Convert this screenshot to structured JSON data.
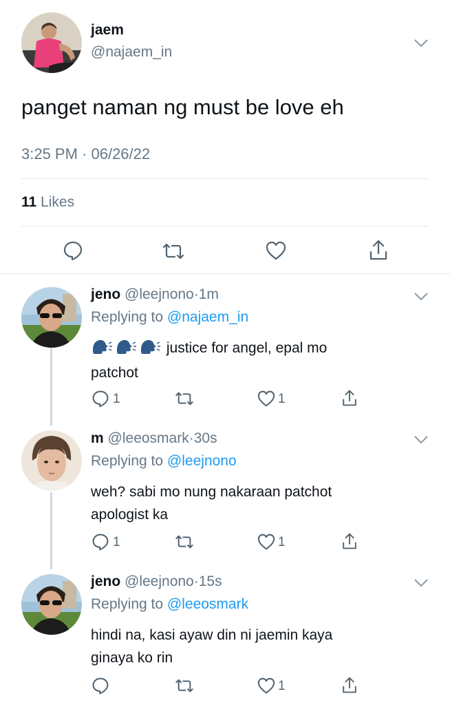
{
  "main_tweet": {
    "display_name": "jaem",
    "handle": "@najaem_in",
    "text": "panget naman ng must be love eh",
    "timestamp": "3:25 PM · 06/26/22",
    "likes_count": "11",
    "likes_label": "Likes"
  },
  "replies": [
    {
      "display_name": "jeno",
      "handle": "@leejnono",
      "time": "1m",
      "replying_prefix": "Replying to",
      "replying_to": "@najaem_in",
      "text_line1": "justice for angel, epal mo",
      "text_line2": "patchot",
      "reply_count": "1",
      "like_count": "1"
    },
    {
      "display_name": "m",
      "handle": "@leeosmark",
      "time": "30s",
      "replying_prefix": "Replying to",
      "replying_to": "@leejnono",
      "text_line1": "weh? sabi mo nung nakaraan patchot",
      "text_line2": "apologist ka",
      "reply_count": "1",
      "like_count": "1"
    },
    {
      "display_name": "jeno",
      "handle": "@leejnono",
      "time": "15s",
      "replying_prefix": "Replying to",
      "replying_to": "@leeosmark",
      "text_line1": "hindi na, kasi ayaw din ni jaemin kaya",
      "text_line2": "ginaya ko rin",
      "reply_count": "",
      "like_count": "1"
    }
  ],
  "separator": "·",
  "emoji": "speaking-head-emoji",
  "colors": {
    "link": "#1d9bf0",
    "muted": "#657786",
    "text": "#0f1419"
  }
}
